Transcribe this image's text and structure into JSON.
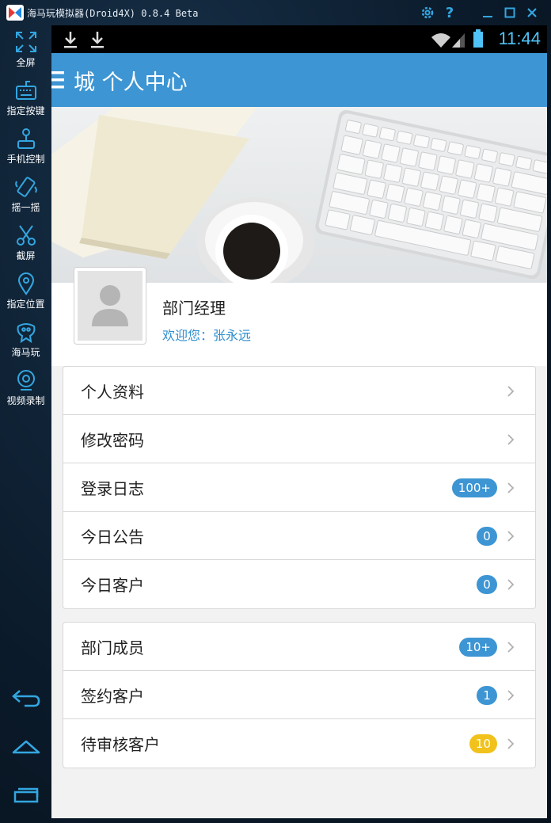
{
  "window": {
    "title": "海马玩模拟器(Droid4X) 0.8.4 Beta",
    "controls": [
      "gear-icon",
      "help-icon",
      "minimize-icon",
      "maximize-icon",
      "close-icon"
    ],
    "accent": "#33a6e0"
  },
  "sidebar": {
    "items": [
      {
        "label": "全屏",
        "icon": "fullscreen-icon"
      },
      {
        "label": "指定按键",
        "icon": "keyboard-icon"
      },
      {
        "label": "手机控制",
        "icon": "joystick-icon"
      },
      {
        "label": "摇一摇",
        "icon": "shake-icon"
      },
      {
        "label": "截屏",
        "icon": "scissors-icon"
      },
      {
        "label": "指定位置",
        "icon": "location-pin-icon"
      },
      {
        "label": "海马玩",
        "icon": "haima-logo-icon"
      },
      {
        "label": "视频录制",
        "icon": "video-record-icon"
      }
    ],
    "nav": [
      "back-icon",
      "home-icon",
      "recent-apps-icon"
    ]
  },
  "statusbar": {
    "time": "11:44",
    "icons": [
      "download-icon",
      "download-icon",
      "wifi-icon",
      "signal-icon",
      "battery-icon"
    ]
  },
  "appbar": {
    "title": "城 个人中心",
    "color": "#3d95d3"
  },
  "profile": {
    "role": "部门经理",
    "welcome": "欢迎您：张永远"
  },
  "menu_groups": [
    {
      "items": [
        {
          "label": "个人资料",
          "badge": null
        },
        {
          "label": "修改密码",
          "badge": null
        },
        {
          "label": "登录日志",
          "badge": "100+",
          "badge_color": "#3d95d3"
        },
        {
          "label": "今日公告",
          "badge": "0",
          "badge_color": "#3d95d3"
        },
        {
          "label": "今日客户",
          "badge": "0",
          "badge_color": "#3d95d3"
        }
      ]
    },
    {
      "items": [
        {
          "label": "部门成员",
          "badge": "10+",
          "badge_color": "#3d95d3"
        },
        {
          "label": "签约客户",
          "badge": "1",
          "badge_color": "#3d95d3"
        },
        {
          "label": "待审核客户",
          "badge": "10",
          "badge_color": "#f1c21b"
        }
      ]
    }
  ]
}
